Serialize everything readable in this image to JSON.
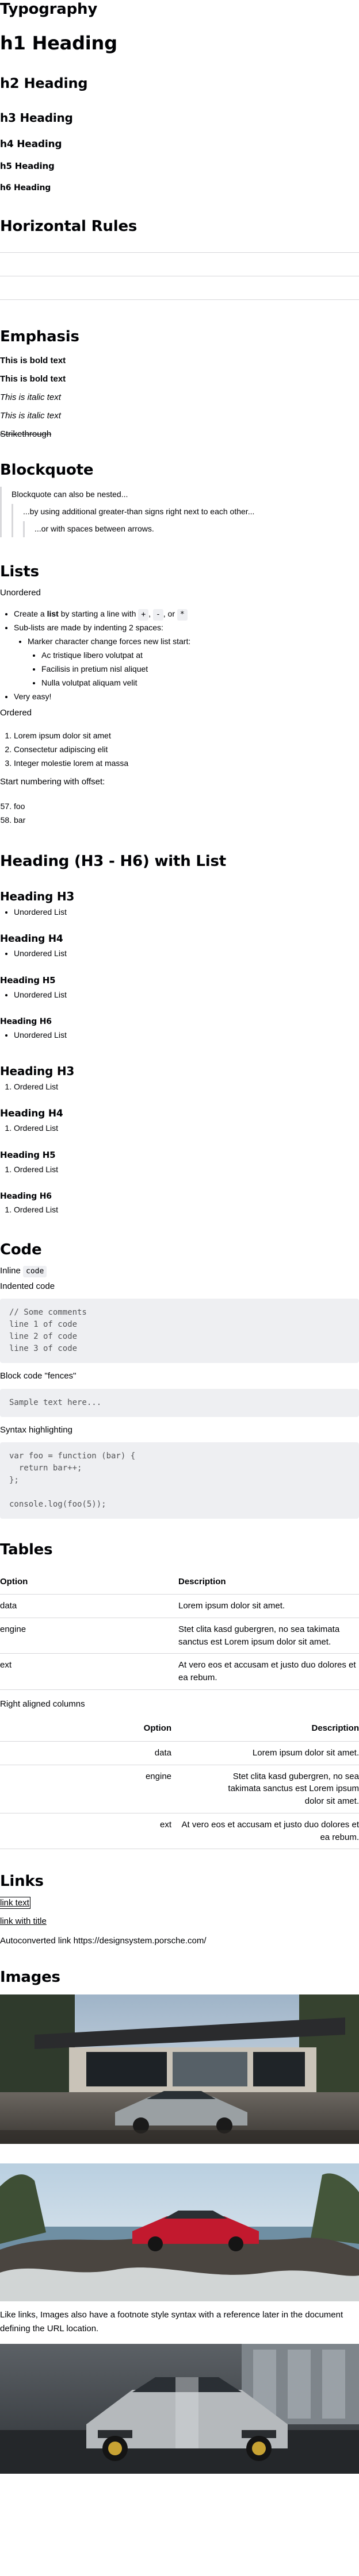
{
  "typography": {
    "title": "Typography",
    "h1": "h1 Heading",
    "h2": "h2 Heading",
    "h3": "h3 Heading",
    "h4": "h4 Heading",
    "h5": "h5 Heading",
    "h6": "h6 Heading"
  },
  "rules": {
    "title": "Horizontal Rules"
  },
  "emphasis": {
    "title": "Emphasis",
    "bold1": "This is bold text",
    "bold2": "This is bold text",
    "italic1": "This is italic text",
    "italic2": "This is italic text",
    "strike": "Strikethrough"
  },
  "blockquote": {
    "title": "Blockquote",
    "l1": "Blockquote can also be nested...",
    "l2": "...by using additional greater-than signs right next to each other...",
    "l3": "...or with spaces between arrows."
  },
  "lists": {
    "title": "Lists",
    "unordered_label": "Unordered",
    "u1_pre": "Create a ",
    "u1_bold": "list",
    "u1_mid": " by starting a line with ",
    "k1": "+",
    "sep1": ", ",
    "k2": "-",
    "sep2": ", or ",
    "k3": "*",
    "u2": "Sub-lists are made by indenting 2 spaces:",
    "u2a": "Marker character change forces new list start:",
    "u2a1": "Ac tristique libero volutpat at",
    "u2a2": "Facilisis in pretium nisl aliquet",
    "u2a3": "Nulla volutpat aliquam velit",
    "u3": "Very easy!",
    "ordered_label": "Ordered",
    "o1": "Lorem ipsum dolor sit amet",
    "o2": "Consectetur adipiscing elit",
    "o3": "Integer molestie lorem at massa",
    "offset_label": "Start numbering with offset:",
    "f1": "foo",
    "f2": "bar"
  },
  "hlists": {
    "title": "Heading (H3 - H6) with List",
    "h3": "Heading H3",
    "h4": "Heading H4",
    "h5": "Heading H5",
    "h6": "Heading H6",
    "ul": "Unordered List",
    "ol": "Ordered List"
  },
  "code": {
    "title": "Code",
    "inline_label": "Inline ",
    "inline_code": "code",
    "indented_label": "Indented code",
    "indented": "// Some comments\nline 1 of code\nline 2 of code\nline 3 of code",
    "fences_label": "Block code \"fences\"",
    "fences": "Sample text here...",
    "syntax_label": "Syntax highlighting",
    "syntax": "var foo = function (bar) {\n  return bar++;\n};\n\nconsole.log(foo(5));"
  },
  "tables": {
    "title": "Tables",
    "headers": [
      "Option",
      "Description"
    ],
    "rows": [
      [
        "data",
        "Lorem ipsum dolor sit amet."
      ],
      [
        "engine",
        "Stet clita kasd gubergren, no sea takimata sanctus est Lorem ipsum dolor sit amet."
      ],
      [
        "ext",
        "At vero eos et accusam et justo duo dolores et ea rebum."
      ]
    ],
    "right_label": "Right aligned columns"
  },
  "links": {
    "title": "Links",
    "link1": "link text",
    "link2": "link with title",
    "auto": "Autoconverted link https://designsystem.porsche.com/"
  },
  "images": {
    "title": "Images",
    "caption": "Like links, Images also have a footnote style syntax with a reference later in the document defining the URL location."
  },
  "colors": {
    "text": "#010205",
    "code_bg": "#eeeff2",
    "rule": "#d8d8db",
    "quote_bar": "#d8d8db"
  }
}
